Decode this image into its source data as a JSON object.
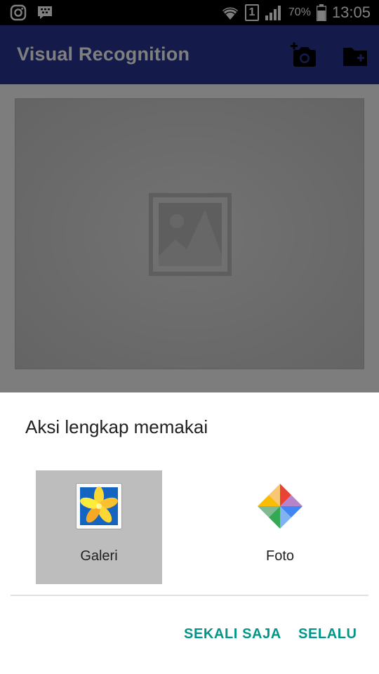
{
  "status_bar": {
    "battery_percent": "70%",
    "sim_slot": "1",
    "time": "13:05",
    "icons": [
      "instagram-icon",
      "bbm-icon",
      "wifi-icon",
      "sim-icon",
      "signal-icon",
      "battery-icon"
    ]
  },
  "app_bar": {
    "title": "Visual Recognition",
    "background_color": "#283593",
    "actions": [
      "add-photo-icon",
      "add-folder-icon"
    ]
  },
  "content": {
    "image_placeholder_icon": "image-placeholder-icon"
  },
  "dialog": {
    "title": "Aksi lengkap memakai",
    "apps": [
      {
        "label": "Galeri",
        "icon": "gallery-app-icon",
        "selected": true
      },
      {
        "label": "Foto",
        "icon": "photos-app-icon",
        "selected": false
      }
    ],
    "buttons": {
      "once": "SEKALI SAJA",
      "always": "SELALU"
    },
    "accent_color": "#009688"
  }
}
